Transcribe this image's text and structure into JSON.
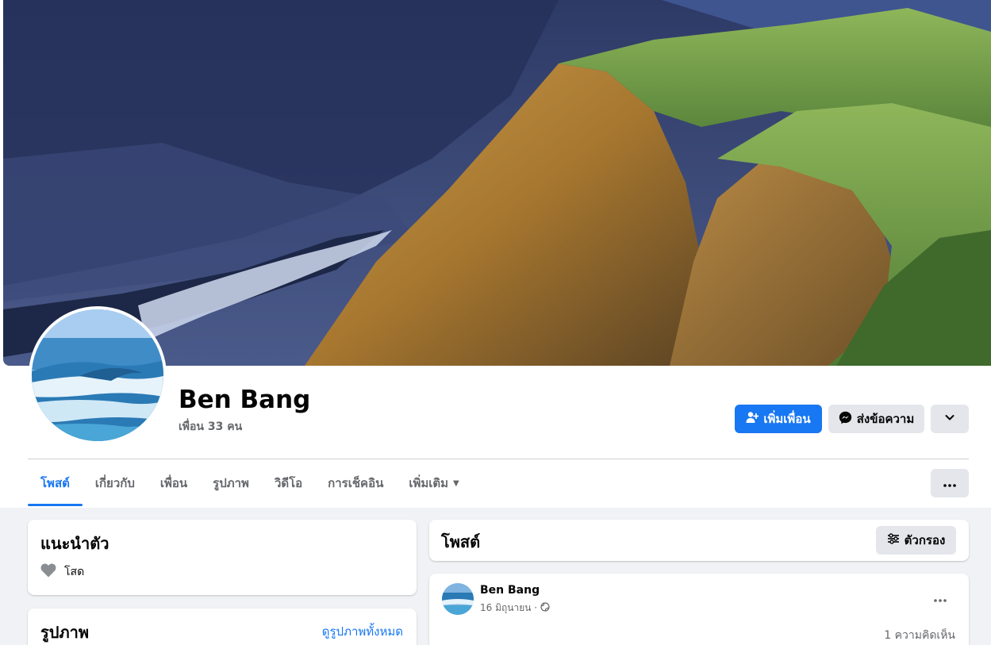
{
  "profile": {
    "name": "Ben Bang",
    "friend_count": "เพื่อน 33 คน"
  },
  "actions": {
    "add_friend": "เพิ่มเพื่อน",
    "message": "ส่งข้อความ"
  },
  "tabs": [
    {
      "label": "โพสต์",
      "active": true
    },
    {
      "label": "เกี่ยวกับ",
      "active": false
    },
    {
      "label": "เพื่อน",
      "active": false
    },
    {
      "label": "รูปภาพ",
      "active": false
    },
    {
      "label": "วิดีโอ",
      "active": false
    },
    {
      "label": "การเช็คอิน",
      "active": false
    },
    {
      "label": "เพิ่มเติม",
      "active": false
    }
  ],
  "intro": {
    "title": "แนะนำตัว",
    "relationship": "โสด"
  },
  "photos": {
    "title": "รูปภาพ",
    "see_all": "ดูรูปภาพทั้งหมด"
  },
  "posts": {
    "title": "โพสต์",
    "filter_label": "ตัวกรอง"
  },
  "post": {
    "author": "Ben Bang",
    "date": "16 มิถุนายน ·",
    "comments": "1 ความคิดเห็น"
  },
  "colors": {
    "accent": "#1877f2",
    "secondary_button": "#e4e6eb",
    "page_background": "#f0f2f5",
    "muted_text": "#65676b"
  },
  "icons": {
    "add_friend": "person-plus-icon",
    "message": "messenger-icon",
    "dropdown": "chevron-down-icon",
    "more": "more-horizontal-icon",
    "relationship": "heart-icon",
    "filter": "filter-icon",
    "privacy": "globe-icon"
  }
}
